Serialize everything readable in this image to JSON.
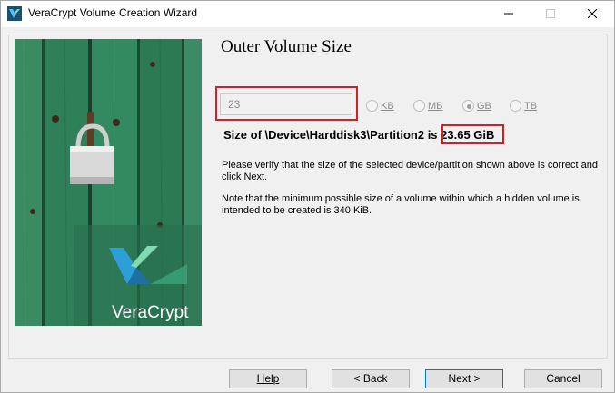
{
  "window": {
    "title": "VeraCrypt Volume Creation Wizard",
    "icon": "veracrypt-logo-icon"
  },
  "titlebar_buttons": {
    "minimize": "minimize-icon",
    "maximize": "maximize-icon",
    "close": "close-icon"
  },
  "sidebar": {
    "brand_text": "VeraCrypt"
  },
  "page": {
    "title": "Outer Volume Size",
    "size_input_value": "23",
    "units": [
      {
        "label": "KB",
        "selected": false
      },
      {
        "label": "MB",
        "selected": false
      },
      {
        "label": "GB",
        "selected": true
      },
      {
        "label": "TB",
        "selected": false
      }
    ],
    "size_prefix": "Size of \\Device\\Harddisk3\\Partition2 is ",
    "size_value": "23.65 GiB",
    "paragraph1": "Please verify that the size of the selected device/partition shown above is correct and click Next.",
    "paragraph2": "Note that the minimum possible size of a volume within which a hidden volume is intended to be created is 340 KiB."
  },
  "buttons": {
    "help": "Help",
    "back": "< Back",
    "next": "Next >",
    "cancel": "Cancel"
  },
  "colors": {
    "highlight_box": "#d0202a",
    "sidebar_green": "#2f7a56"
  }
}
